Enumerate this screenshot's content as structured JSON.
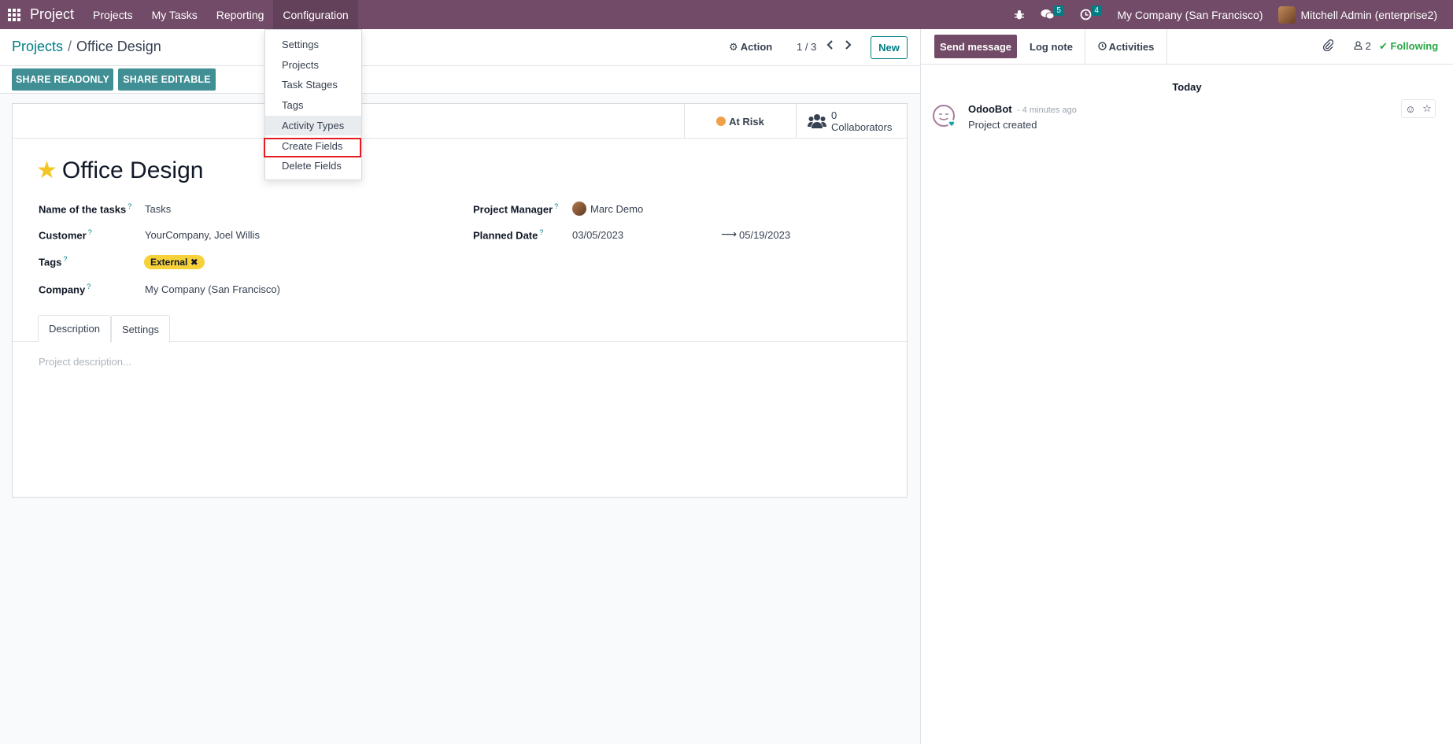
{
  "topbar": {
    "app_name": "Project",
    "menu": [
      "Projects",
      "My Tasks",
      "Reporting",
      "Configuration"
    ],
    "messages_count": "5",
    "activities_count": "4",
    "company": "My Company (San Francisco)",
    "user": "Mitchell Admin (enterprise2)"
  },
  "control_panel": {
    "breadcrumb_parent": "Projects",
    "breadcrumb_separator": "/",
    "breadcrumb_current": "Office Design",
    "action_label": "Action",
    "pager": "1 / 3",
    "new_label": "New"
  },
  "header": {
    "share_readonly": "SHARE READONLY",
    "share_editable": "SHARE EDITABLE"
  },
  "config_menu": {
    "items": [
      "Settings",
      "Projects",
      "Task Stages",
      "Tags",
      "Activity Types",
      "Create Fields",
      "Delete Fields"
    ],
    "hovered": "Activity Types",
    "highlighted": "Create Fields"
  },
  "form": {
    "status": "At Risk",
    "status_color": "#f0a04b",
    "collaborators_count": "0",
    "collaborators_label": "Collaborators",
    "title": "Office Design",
    "favorite": true,
    "fields": {
      "tasks_name_label": "Name of the tasks",
      "tasks_name_value": "Tasks",
      "customer_label": "Customer",
      "customer_value": "YourCompany, Joel Willis",
      "tags_label": "Tags",
      "tag_value": "External",
      "company_label": "Company",
      "company_value": "My Company (San Francisco)",
      "manager_label": "Project Manager",
      "manager_value": "Marc Demo",
      "planned_label": "Planned Date",
      "planned_start": "03/05/2023",
      "planned_end": "05/19/2023",
      "help_mark": "?"
    },
    "tabs": [
      "Description",
      "Settings"
    ],
    "active_tab": "Description",
    "description_placeholder": "Project description..."
  },
  "chatter": {
    "send_message": "Send message",
    "log_note": "Log note",
    "activities": "Activities",
    "follower_count": "2",
    "following": "Following",
    "date_separator": "Today",
    "message": {
      "author": "OdooBot",
      "time": "- 4 minutes ago",
      "body": "Project created"
    }
  },
  "colors": {
    "brand": "#714b67",
    "accent": "#017e84",
    "highlight": "#e41b23"
  }
}
